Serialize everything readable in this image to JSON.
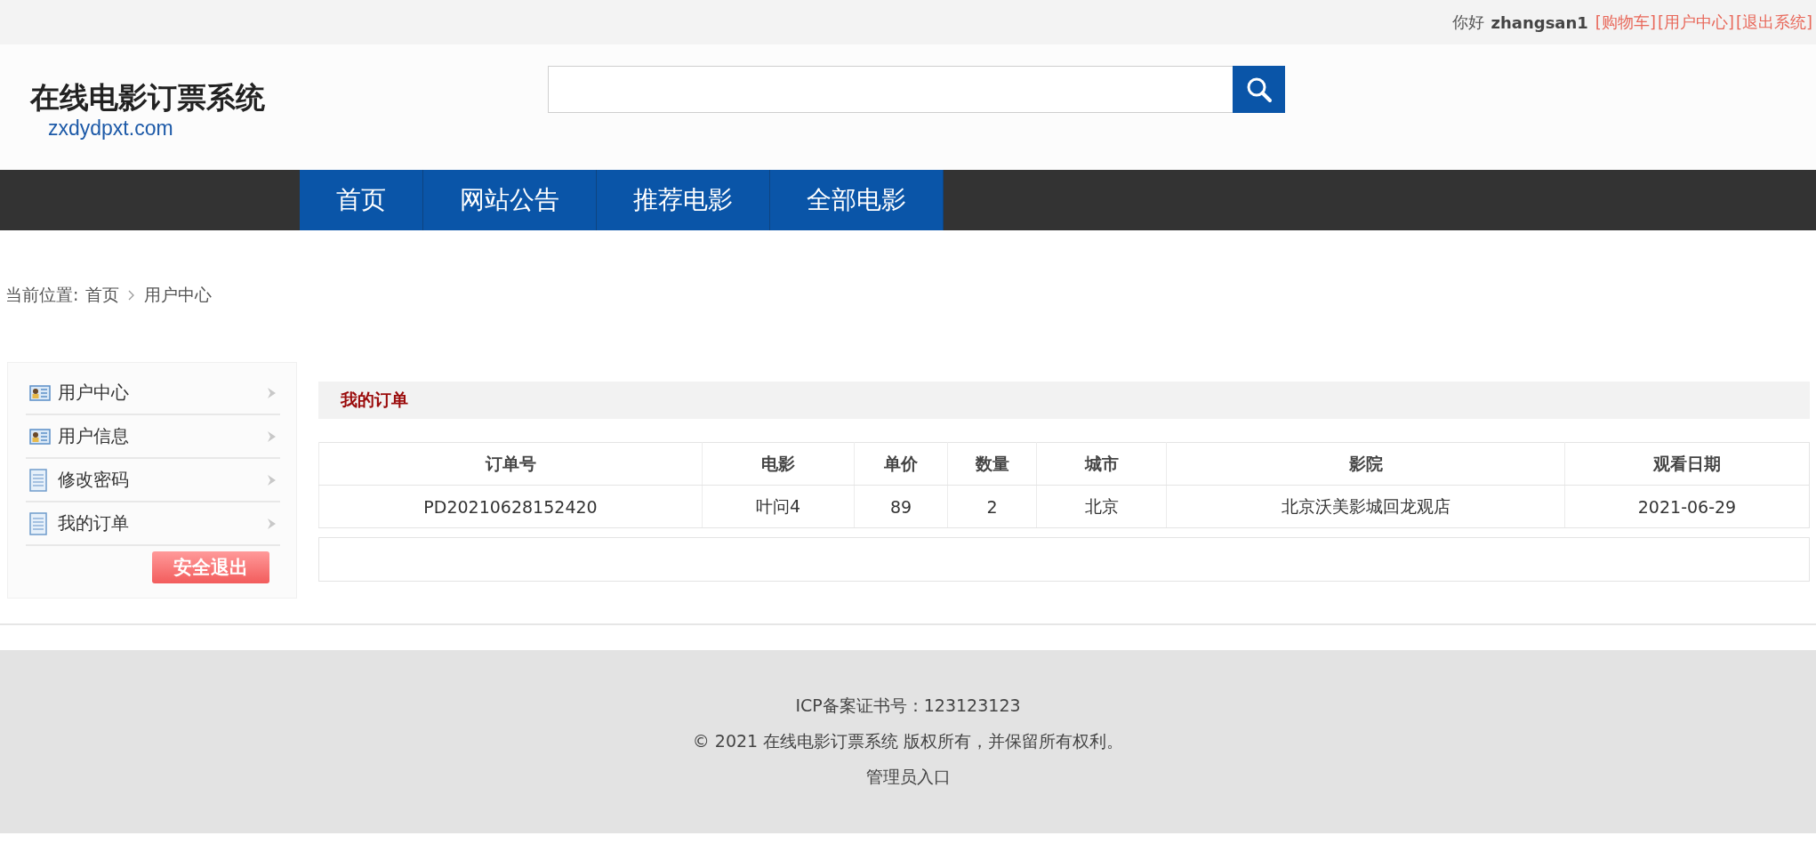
{
  "top_bar": {
    "greeting": "你好",
    "username": "zhangsan1",
    "links": [
      "[购物车]",
      "[用户中心]",
      "[退出系统]"
    ]
  },
  "logo": {
    "title": "在线电影订票系统",
    "domain": "zxdydpxt.com"
  },
  "nav": [
    "首页",
    "网站公告",
    "推荐电影",
    "全部电影"
  ],
  "breadcrumb": {
    "label": "当前位置:",
    "items": [
      "首页",
      "用户中心"
    ]
  },
  "sidebar": {
    "items": [
      {
        "label": "用户中心",
        "kind": "card"
      },
      {
        "label": "用户信息",
        "kind": "card"
      },
      {
        "label": "修改密码",
        "kind": "document"
      },
      {
        "label": "我的订单",
        "kind": "document"
      }
    ],
    "logout_button": "安全退出"
  },
  "orders": {
    "title": "我的订单",
    "columns": [
      "订单号",
      "电影",
      "单价",
      "数量",
      "城市",
      "影院",
      "观看日期"
    ],
    "rows": [
      [
        "PD20210628152420",
        "叶问4",
        "89",
        "2",
        "北京",
        "北京沃美影城回龙观店",
        "2021-06-29"
      ]
    ]
  },
  "footer": {
    "icp": "ICP备案证书号：123123123",
    "copyright": "© 2021 在线电影订票系统 版权所有，并保留所有权利。",
    "admin_link": "管理员入口"
  }
}
